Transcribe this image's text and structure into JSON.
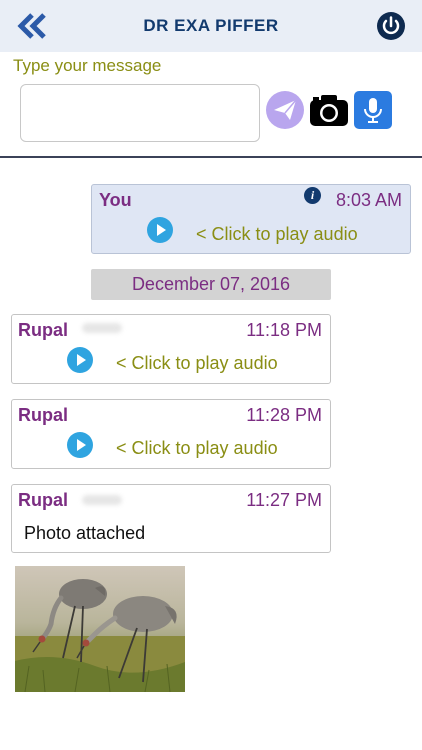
{
  "header": {
    "title": "DR EXA PIFFER",
    "back_icon": "double-chevron-left-icon",
    "power_icon": "power-icon"
  },
  "composer": {
    "label": "Type your message",
    "input_value": "",
    "send_icon": "send-icon",
    "camera_icon": "camera-icon",
    "mic_icon": "microphone-icon"
  },
  "messages": [
    {
      "sender": "You",
      "time": "8:03 AM",
      "text": "< Click to play audio",
      "type": "audio"
    },
    {
      "date_separator": "December 07, 2016"
    },
    {
      "sender": "Rupal",
      "time": "11:18 PM",
      "text": "< Click to play audio",
      "type": "audio"
    },
    {
      "sender": "Rupal",
      "time": "11:28 PM",
      "text": "< Click to play audio",
      "type": "audio"
    },
    {
      "sender": "Rupal",
      "time": "11:27 PM",
      "text": "Photo attached",
      "type": "photo"
    }
  ],
  "colors": {
    "header_bg": "#e9eef6",
    "title": "#123a6e",
    "accent_purple": "#7b2d82",
    "audio_text": "#8a8e14",
    "play_blue": "#2fa4e0",
    "mine_bg": "#dfe6f4"
  }
}
